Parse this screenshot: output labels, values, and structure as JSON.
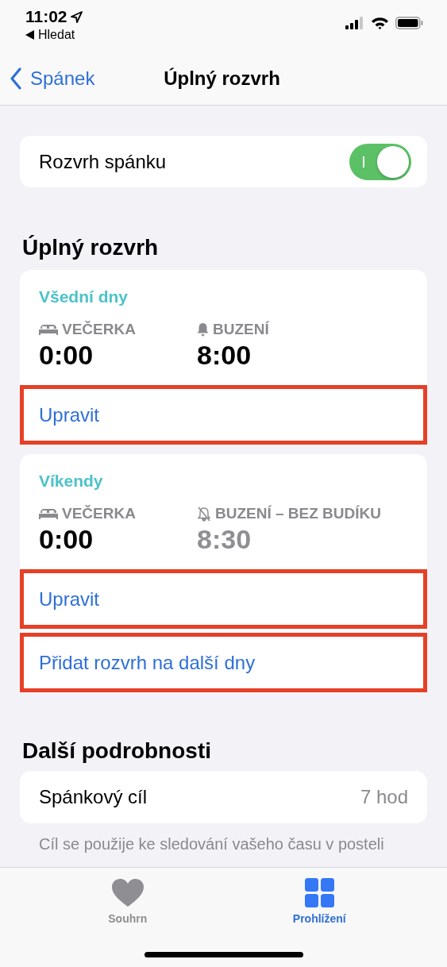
{
  "status_bar": {
    "time": "11:02",
    "back_label": "Hledat"
  },
  "nav": {
    "back": "Spánek",
    "title": "Úplný rozvrh"
  },
  "schedule_toggle": {
    "label": "Rozvrh spánku",
    "on": true
  },
  "full_schedule": {
    "heading": "Úplný rozvrh",
    "schedules": [
      {
        "title": "Všední dny",
        "bedtime": {
          "label": "VEČERKA",
          "time": "0:00"
        },
        "wake": {
          "label": "BUZENÍ",
          "time": "8:00",
          "alarm_on": true
        },
        "actions": [
          {
            "label": "Upravit",
            "highlighted": true
          }
        ]
      },
      {
        "title": "Víkendy",
        "bedtime": {
          "label": "VEČERKA",
          "time": "0:00"
        },
        "wake": {
          "label": "BUZENÍ – BEZ BUDÍKU",
          "time": "8:30",
          "alarm_on": false
        },
        "actions": [
          {
            "label": "Upravit",
            "highlighted": true
          },
          {
            "label": "Přidat rozvrh na další dny",
            "highlighted": true
          }
        ]
      }
    ]
  },
  "details": {
    "heading": "Další podrobnosti",
    "rows": [
      {
        "label": "Spánkový cíl",
        "value": "7 hod"
      }
    ],
    "footnote": "Cíl se použije ke sledování vašeho času v posteli"
  },
  "tab_bar": [
    {
      "kind": "heart",
      "label": "Souhrn",
      "selected": false
    },
    {
      "kind": "grid",
      "label": "Prohlížení",
      "selected": true
    }
  ]
}
